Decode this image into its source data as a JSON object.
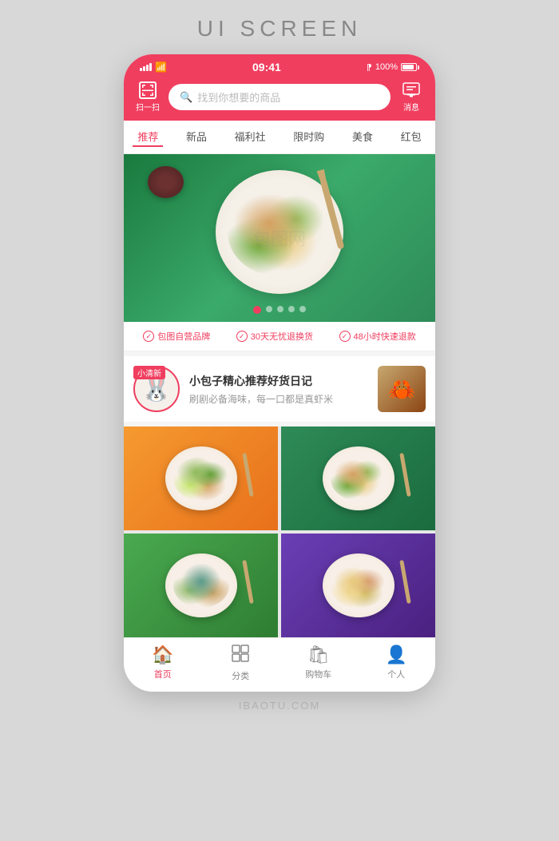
{
  "page": {
    "title": "UI SCREEN",
    "bottom_brand": "IBAOTU.COM"
  },
  "status_bar": {
    "time": "09:41",
    "battery_pct": "100%",
    "bluetooth": "⁋"
  },
  "header": {
    "scan_label": "扫一扫",
    "search_placeholder": "找到你想要的商品",
    "message_label": "消息"
  },
  "nav_tabs": [
    {
      "id": "recommend",
      "label": "推荐",
      "active": true
    },
    {
      "id": "new",
      "label": "新品",
      "active": false
    },
    {
      "id": "welfare",
      "label": "福利社",
      "active": false
    },
    {
      "id": "flash",
      "label": "限时购",
      "active": false
    },
    {
      "id": "food",
      "label": "美食",
      "active": false
    },
    {
      "id": "redpacket",
      "label": "红包",
      "active": false
    }
  ],
  "banner": {
    "dots": [
      true,
      false,
      false,
      false,
      false
    ]
  },
  "trust_items": [
    {
      "text": "包图自营品牌"
    },
    {
      "text": "30天无忧退换货"
    },
    {
      "text": "48小时快速退款"
    }
  ],
  "blog": {
    "tag": "小清新",
    "avatar_char": "🐰",
    "title": "小包子精心推荐好货日记",
    "subtitle": "刷剧必备海味，每一口都是真虾米"
  },
  "food_cards": [
    {
      "id": 1,
      "color": "orange",
      "food_type": "food1"
    },
    {
      "id": 2,
      "color": "green",
      "food_type": "food2"
    },
    {
      "id": 3,
      "color": "green2",
      "food_type": "food3"
    },
    {
      "id": 4,
      "color": "purple",
      "food_type": "food4"
    }
  ],
  "bottom_nav": [
    {
      "id": "home",
      "icon": "🏠",
      "label": "首页",
      "active": true
    },
    {
      "id": "category",
      "icon": "▦",
      "label": "分类",
      "active": false
    },
    {
      "id": "cart",
      "icon": "🛍",
      "label": "购物车",
      "active": false
    },
    {
      "id": "profile",
      "icon": "👤",
      "label": "个人",
      "active": false
    }
  ]
}
